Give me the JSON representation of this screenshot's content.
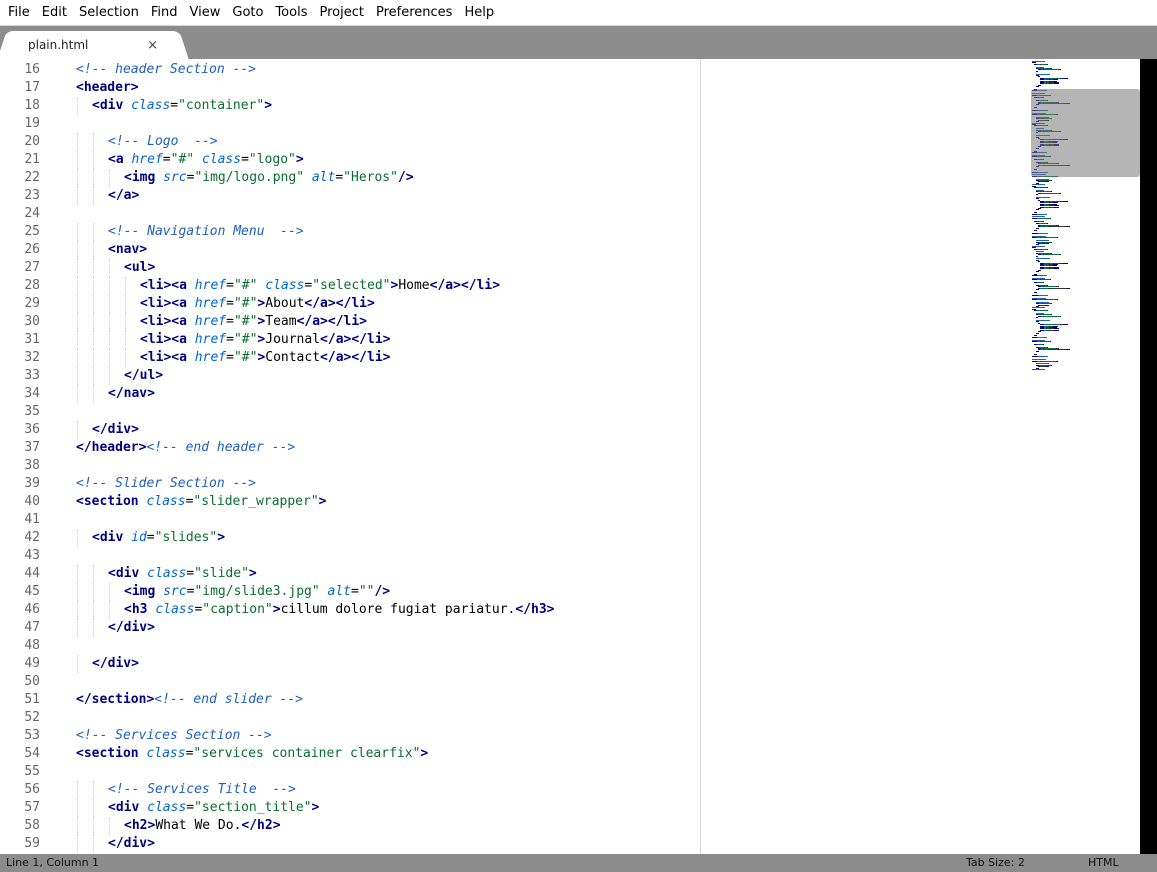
{
  "menu": [
    "File",
    "Edit",
    "Selection",
    "Find",
    "View",
    "Goto",
    "Tools",
    "Project",
    "Preferences",
    "Help"
  ],
  "tab": {
    "filename": "plain.html",
    "close_glyph": "×"
  },
  "status": {
    "position": "Line 1, Column 1",
    "tab_size": "Tab Size: 2",
    "syntax": "HTML"
  },
  "code_lines": [
    {
      "n": "16",
      "indent": 0,
      "t": [
        [
          "cmt",
          "<!-- header Section -->"
        ]
      ]
    },
    {
      "n": "17",
      "indent": 0,
      "t": [
        [
          "tag",
          "<header>"
        ]
      ]
    },
    {
      "n": "18",
      "indent": 1,
      "t": [
        [
          "tag",
          "<div "
        ],
        [
          "attr",
          "class"
        ],
        [
          "pun",
          "="
        ],
        [
          "str",
          "\"container\""
        ],
        [
          "tag",
          ">"
        ]
      ]
    },
    {
      "n": "19",
      "indent": 0,
      "t": []
    },
    {
      "n": "20",
      "indent": 2,
      "t": [
        [
          "cmt",
          "<!-- Logo  -->"
        ]
      ]
    },
    {
      "n": "21",
      "indent": 2,
      "t": [
        [
          "tag",
          "<a "
        ],
        [
          "attr",
          "href"
        ],
        [
          "pun",
          "="
        ],
        [
          "str",
          "\"#\""
        ],
        [
          "pun",
          " "
        ],
        [
          "attr",
          "class"
        ],
        [
          "pun",
          "="
        ],
        [
          "str",
          "\"logo\""
        ],
        [
          "tag",
          ">"
        ]
      ]
    },
    {
      "n": "22",
      "indent": 3,
      "t": [
        [
          "tag",
          "<img "
        ],
        [
          "attr",
          "src"
        ],
        [
          "pun",
          "="
        ],
        [
          "str",
          "\"img/logo.png\""
        ],
        [
          "pun",
          " "
        ],
        [
          "attr",
          "alt"
        ],
        [
          "pun",
          "="
        ],
        [
          "str",
          "\"Heros\""
        ],
        [
          "tag",
          "/>"
        ]
      ]
    },
    {
      "n": "23",
      "indent": 2,
      "t": [
        [
          "tag",
          "</a>"
        ]
      ]
    },
    {
      "n": "24",
      "indent": 0,
      "t": []
    },
    {
      "n": "25",
      "indent": 2,
      "t": [
        [
          "cmt",
          "<!-- Navigation Menu  -->"
        ]
      ]
    },
    {
      "n": "26",
      "indent": 2,
      "t": [
        [
          "tag",
          "<nav>"
        ]
      ]
    },
    {
      "n": "27",
      "indent": 3,
      "t": [
        [
          "tag",
          "<ul>"
        ]
      ]
    },
    {
      "n": "28",
      "indent": 4,
      "t": [
        [
          "tag",
          "<li><a "
        ],
        [
          "attr",
          "href"
        ],
        [
          "pun",
          "="
        ],
        [
          "str",
          "\"#\""
        ],
        [
          "pun",
          " "
        ],
        [
          "attr",
          "class"
        ],
        [
          "pun",
          "="
        ],
        [
          "str",
          "\"selected\""
        ],
        [
          "tag",
          ">"
        ],
        [
          "txt",
          "Home"
        ],
        [
          "tag",
          "</a></li>"
        ]
      ]
    },
    {
      "n": "29",
      "indent": 4,
      "t": [
        [
          "tag",
          "<li><a "
        ],
        [
          "attr",
          "href"
        ],
        [
          "pun",
          "="
        ],
        [
          "str",
          "\"#\""
        ],
        [
          "tag",
          ">"
        ],
        [
          "txt",
          "About"
        ],
        [
          "tag",
          "</a></li>"
        ]
      ]
    },
    {
      "n": "30",
      "indent": 4,
      "t": [
        [
          "tag",
          "<li><a "
        ],
        [
          "attr",
          "href"
        ],
        [
          "pun",
          "="
        ],
        [
          "str",
          "\"#\""
        ],
        [
          "tag",
          ">"
        ],
        [
          "txt",
          "Team"
        ],
        [
          "tag",
          "</a></li>"
        ]
      ]
    },
    {
      "n": "31",
      "indent": 4,
      "t": [
        [
          "tag",
          "<li><a "
        ],
        [
          "attr",
          "href"
        ],
        [
          "pun",
          "="
        ],
        [
          "str",
          "\"#\""
        ],
        [
          "tag",
          ">"
        ],
        [
          "txt",
          "Journal"
        ],
        [
          "tag",
          "</a></li>"
        ]
      ]
    },
    {
      "n": "32",
      "indent": 4,
      "t": [
        [
          "tag",
          "<li><a "
        ],
        [
          "attr",
          "href"
        ],
        [
          "pun",
          "="
        ],
        [
          "str",
          "\"#\""
        ],
        [
          "tag",
          ">"
        ],
        [
          "txt",
          "Contact"
        ],
        [
          "tag",
          "</a></li>"
        ]
      ]
    },
    {
      "n": "33",
      "indent": 3,
      "t": [
        [
          "tag",
          "</ul>"
        ]
      ]
    },
    {
      "n": "34",
      "indent": 2,
      "t": [
        [
          "tag",
          "</nav>"
        ]
      ]
    },
    {
      "n": "35",
      "indent": 0,
      "t": []
    },
    {
      "n": "36",
      "indent": 1,
      "t": [
        [
          "tag",
          "</div>"
        ]
      ]
    },
    {
      "n": "37",
      "indent": 0,
      "t": [
        [
          "tag",
          "</header>"
        ],
        [
          "cmt",
          "<!-- end header -->"
        ]
      ]
    },
    {
      "n": "38",
      "indent": 0,
      "t": []
    },
    {
      "n": "39",
      "indent": 0,
      "t": [
        [
          "cmt",
          "<!-- Slider Section -->"
        ]
      ]
    },
    {
      "n": "40",
      "indent": 0,
      "t": [
        [
          "tag",
          "<section "
        ],
        [
          "attr",
          "class"
        ],
        [
          "pun",
          "="
        ],
        [
          "str",
          "\"slider_wrapper\""
        ],
        [
          "tag",
          ">"
        ]
      ]
    },
    {
      "n": "41",
      "indent": 0,
      "t": []
    },
    {
      "n": "42",
      "indent": 1,
      "t": [
        [
          "tag",
          "<div "
        ],
        [
          "attr",
          "id"
        ],
        [
          "pun",
          "="
        ],
        [
          "str",
          "\"slides\""
        ],
        [
          "tag",
          ">"
        ]
      ]
    },
    {
      "n": "43",
      "indent": 0,
      "t": []
    },
    {
      "n": "44",
      "indent": 2,
      "t": [
        [
          "tag",
          "<div "
        ],
        [
          "attr",
          "class"
        ],
        [
          "pun",
          "="
        ],
        [
          "str",
          "\"slide\""
        ],
        [
          "tag",
          ">"
        ]
      ]
    },
    {
      "n": "45",
      "indent": 3,
      "t": [
        [
          "tag",
          "<img "
        ],
        [
          "attr",
          "src"
        ],
        [
          "pun",
          "="
        ],
        [
          "str",
          "\"img/slide3.jpg\""
        ],
        [
          "pun",
          " "
        ],
        [
          "attr",
          "alt"
        ],
        [
          "pun",
          "="
        ],
        [
          "str",
          "\"\""
        ],
        [
          "tag",
          "/>"
        ]
      ]
    },
    {
      "n": "46",
      "indent": 3,
      "t": [
        [
          "tag",
          "<h3 "
        ],
        [
          "attr",
          "class"
        ],
        [
          "pun",
          "="
        ],
        [
          "str",
          "\"caption\""
        ],
        [
          "tag",
          ">"
        ],
        [
          "txt",
          "cillum dolore fugiat pariatur."
        ],
        [
          "tag",
          "</h3>"
        ]
      ]
    },
    {
      "n": "47",
      "indent": 2,
      "t": [
        [
          "tag",
          "</div>"
        ]
      ]
    },
    {
      "n": "48",
      "indent": 0,
      "t": []
    },
    {
      "n": "49",
      "indent": 1,
      "t": [
        [
          "tag",
          "</div>"
        ]
      ]
    },
    {
      "n": "50",
      "indent": 0,
      "t": []
    },
    {
      "n": "51",
      "indent": 0,
      "t": [
        [
          "tag",
          "</section>"
        ],
        [
          "cmt",
          "<!-- end slider -->"
        ]
      ]
    },
    {
      "n": "52",
      "indent": 0,
      "t": []
    },
    {
      "n": "53",
      "indent": 0,
      "t": [
        [
          "cmt",
          "<!-- Services Section -->"
        ]
      ]
    },
    {
      "n": "54",
      "indent": 0,
      "t": [
        [
          "tag",
          "<section "
        ],
        [
          "attr",
          "class"
        ],
        [
          "pun",
          "="
        ],
        [
          "str",
          "\"services container clearfix\""
        ],
        [
          "tag",
          ">"
        ]
      ]
    },
    {
      "n": "55",
      "indent": 0,
      "t": []
    },
    {
      "n": "56",
      "indent": 2,
      "t": [
        [
          "cmt",
          "<!-- Services Title  -->"
        ]
      ]
    },
    {
      "n": "57",
      "indent": 2,
      "t": [
        [
          "tag",
          "<div "
        ],
        [
          "attr",
          "class"
        ],
        [
          "pun",
          "="
        ],
        [
          "str",
          "\"section_title\""
        ],
        [
          "tag",
          ">"
        ]
      ]
    },
    {
      "n": "58",
      "indent": 3,
      "t": [
        [
          "tag",
          "<h2>"
        ],
        [
          "txt",
          "What We Do."
        ],
        [
          "tag",
          "</h2>"
        ]
      ]
    },
    {
      "n": "59",
      "indent": 2,
      "t": [
        [
          "tag",
          "</div>"
        ]
      ]
    }
  ],
  "colors": {
    "tag": "#000080",
    "attr": "#0066cc",
    "string": "#0a6e2f",
    "comment": "#1e5fbf",
    "tabbar": "#8c8c8c",
    "statusbar": "#8c8c8c",
    "minimap_viewport": "#787878"
  }
}
